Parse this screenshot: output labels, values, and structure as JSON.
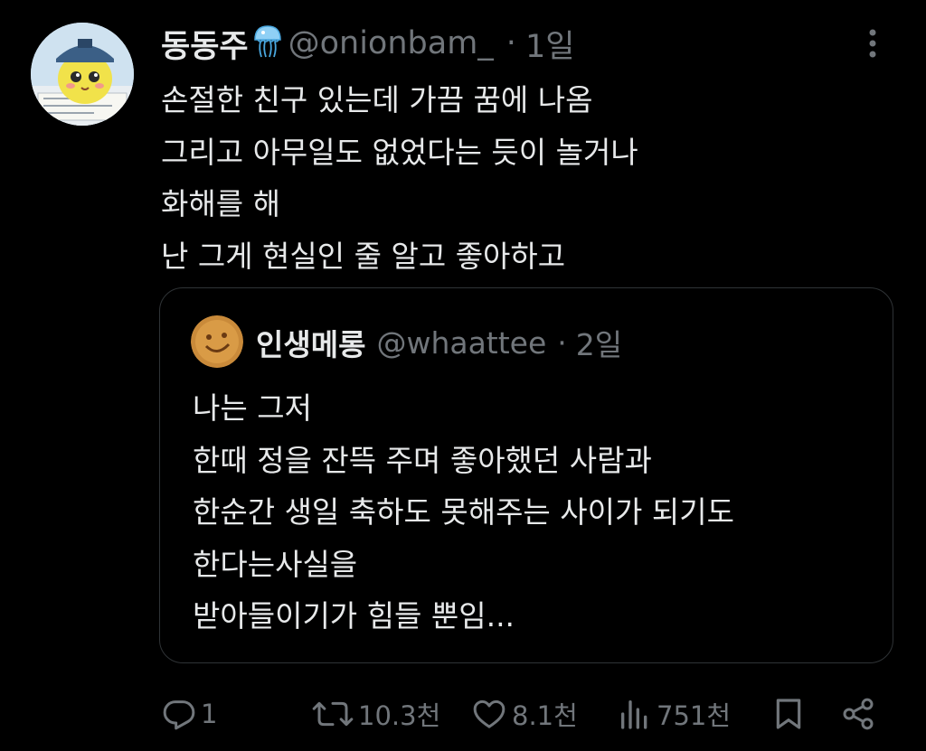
{
  "tweet": {
    "display_name": "동동주",
    "name_emoji": "jellyfish-emoji",
    "handle": "@onionbam_",
    "separator": "·",
    "time": "1일",
    "lines": [
      "손절한 친구 있는데 가끔 꿈에 나옴",
      "그리고 아무일도 없었다는 듯이 놀거나",
      "화해를 해",
      "난 그게 현실인 줄 알고 좋아하고"
    ]
  },
  "quoted_tweet": {
    "display_name": "인생메롱",
    "handle": "@whaattee",
    "separator": "·",
    "time": "2일",
    "lines": [
      "나는 그저",
      "한때 정을 잔뜩 주며 좋아했던 사람과",
      "한순간 생일 축하도 못해주는 사이가 되기도",
      "한다는사실을",
      "받아들이기가 힘들 뿐임..."
    ]
  },
  "actions": {
    "reply_icon": "reply-icon",
    "replies": "1",
    "retweet_icon": "retweet-icon",
    "retweets": "10.3천",
    "like_icon": "heart-icon",
    "likes": "8.1천",
    "views_icon": "views-icon",
    "views": "751천",
    "bookmark_icon": "bookmark-icon",
    "share_icon": "share-icon"
  },
  "colors": {
    "background": "#000000",
    "text_primary": "#e7e9ea",
    "text_secondary": "#71767b",
    "border": "#2f3336"
  }
}
